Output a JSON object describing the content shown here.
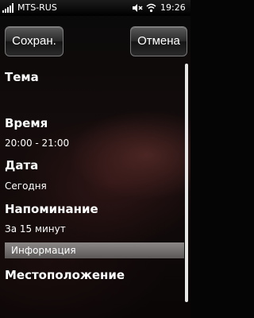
{
  "status_bar": {
    "carrier": "MTS-RUS",
    "time": "19:26",
    "icons": [
      "signal-icon",
      "mute-icon",
      "wifi-icon"
    ]
  },
  "toolbar": {
    "save_label": "Сохран.",
    "cancel_label": "Отмена"
  },
  "form": {
    "subject_label": "Тема",
    "subject_value": "",
    "time_label": "Время",
    "time_value": "20:00 - 21:00",
    "date_label": "Дата",
    "date_value": "Сегодня",
    "reminder_label": "Напоминание",
    "reminder_value": "За 15 минут",
    "info_section": "Информация",
    "location_label": "Местоположение"
  },
  "colors": {
    "section_bg": "#7a7676",
    "scrollbar": "#e8e8e8"
  }
}
